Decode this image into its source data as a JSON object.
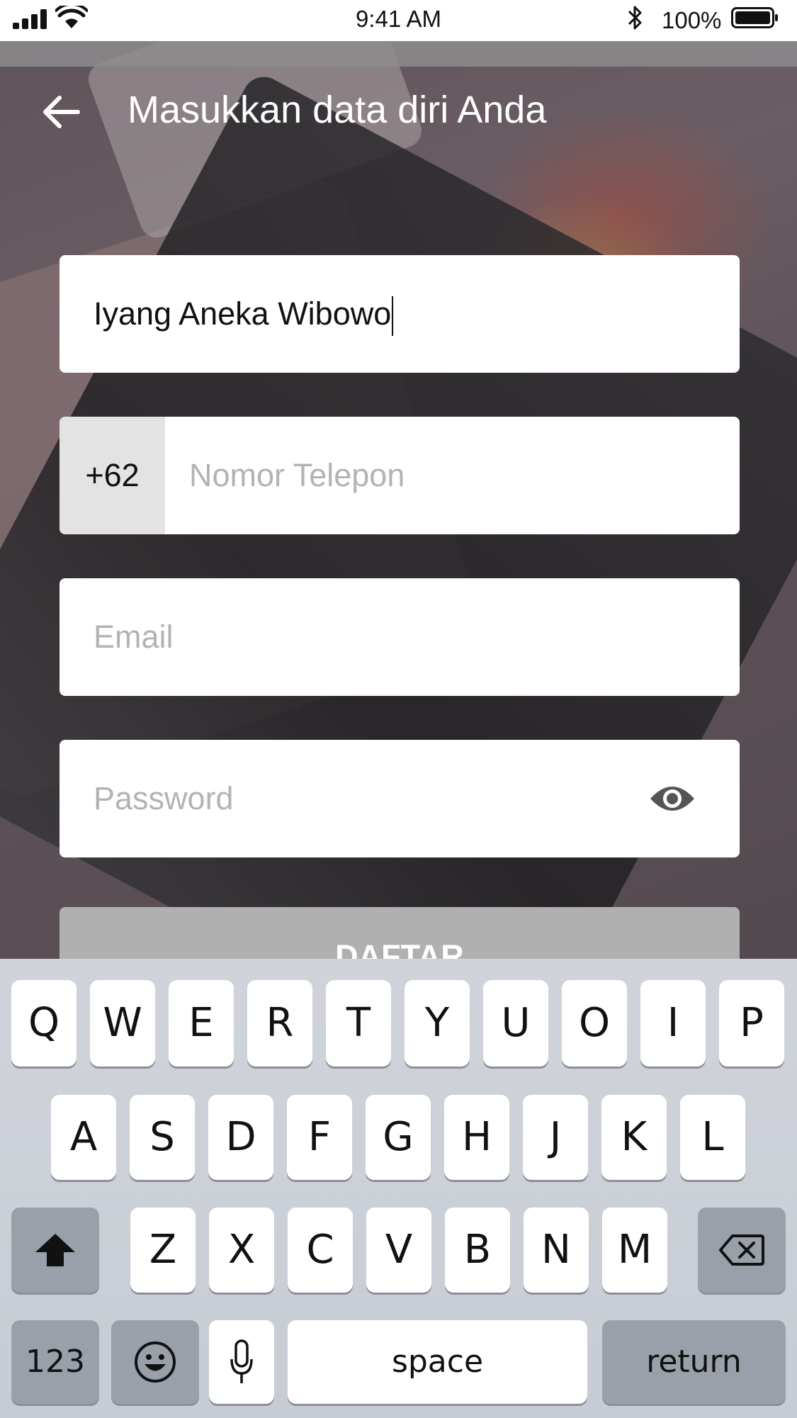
{
  "status_bar": {
    "time": "9:41 AM",
    "battery": "100%"
  },
  "header": {
    "title": "Masukkan data diri Anda"
  },
  "form": {
    "name_value": "Iyang Aneka Wibowo",
    "phone_prefix": "+62",
    "phone_placeholder": "Nomor Telepon",
    "email_placeholder": "Email",
    "password_placeholder": "Password",
    "submit_label": "DAFTAR"
  },
  "keyboard": {
    "row1": [
      "Q",
      "W",
      "E",
      "R",
      "T",
      "Y",
      "U",
      "O",
      "I",
      "P"
    ],
    "row2": [
      "A",
      "S",
      "D",
      "F",
      "G",
      "H",
      "J",
      "K",
      "L"
    ],
    "row3": [
      "Z",
      "X",
      "C",
      "V",
      "B",
      "N",
      "M"
    ],
    "numbers_label": "123",
    "space_label": "space",
    "return_label": "return"
  },
  "icons": {
    "back": "arrow-left-icon",
    "password_toggle": "eye-icon",
    "shift": "shift-arrow-icon",
    "backspace": "backspace-icon",
    "emoji": "emoji-icon",
    "mic": "microphone-icon"
  },
  "colors": {
    "field_bg": "#ffffff",
    "prefix_bg": "#e3e3e3",
    "placeholder": "#b3b3b3",
    "submit_bg": "#b0b0b0",
    "keyboard_bg": "#d0d3da"
  }
}
